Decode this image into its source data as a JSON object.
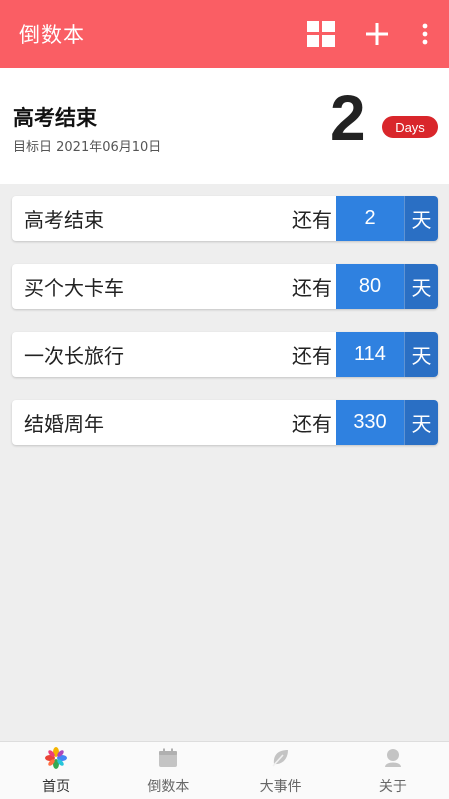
{
  "appbar": {
    "title": "倒数本",
    "grid_icon": "grid-icon",
    "add_icon": "plus-icon",
    "more_icon": "more-vertical-icon",
    "color": "#fa5e64"
  },
  "hero": {
    "event_name": "高考结束",
    "target_date": "目标日 2021年06月10日",
    "days_count": "2",
    "days_label": "Days"
  },
  "events": [
    {
      "name": "高考结束",
      "prefix": "还有",
      "days": "2",
      "unit": "天"
    },
    {
      "name": "买个大卡车",
      "prefix": "还有",
      "days": "80",
      "unit": "天"
    },
    {
      "name": "一次长旅行",
      "prefix": "还有",
      "days": "114",
      "unit": "天"
    },
    {
      "name": "结婚周年",
      "prefix": "还有",
      "days": "330",
      "unit": "天"
    }
  ],
  "bottom_nav": [
    {
      "label": "首页",
      "icon": "pinwheel-icon",
      "active": true
    },
    {
      "label": "倒数本",
      "icon": "calendar-icon",
      "active": false
    },
    {
      "label": "大事件",
      "icon": "leaf-icon",
      "active": false
    },
    {
      "label": "关于",
      "icon": "person-icon",
      "active": false
    }
  ],
  "colors": {
    "accent": "#fa5e64",
    "badge": "#d9262b",
    "number_bg": "#2f81e0",
    "unit_bg": "#2a6fc4"
  }
}
